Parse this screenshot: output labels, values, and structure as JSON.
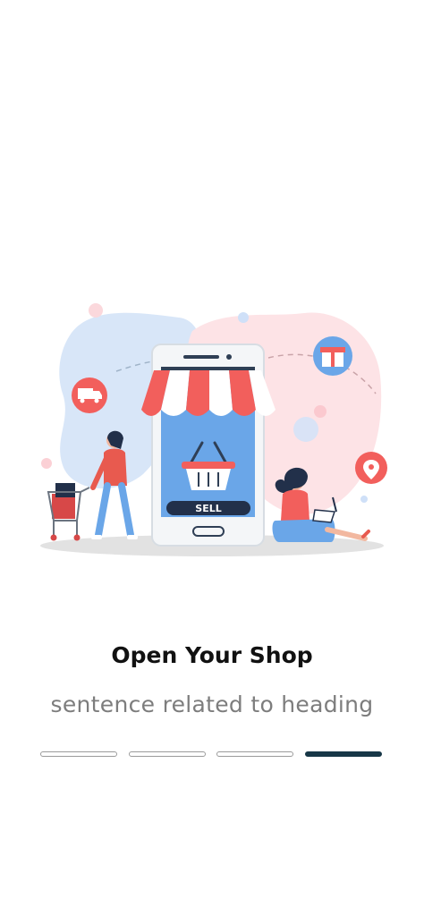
{
  "onboarding": {
    "title": "Open Your Shop",
    "subtitle": "sentence related to heading",
    "illustration": {
      "store_sign": "SELL",
      "icons": [
        "truck-icon",
        "gift-icon",
        "location-pin-icon",
        "shopping-basket-icon"
      ]
    },
    "pager": {
      "total": 4,
      "active_index": 3
    }
  },
  "colors": {
    "accent": "#173747",
    "awning_red": "#f25f5c",
    "phone_screen": "#6aa6e8",
    "blob_blue": "#d8e6f8",
    "blob_pink": "#fde3e6",
    "title": "#111111",
    "subtitle": "#7d7d7d"
  }
}
